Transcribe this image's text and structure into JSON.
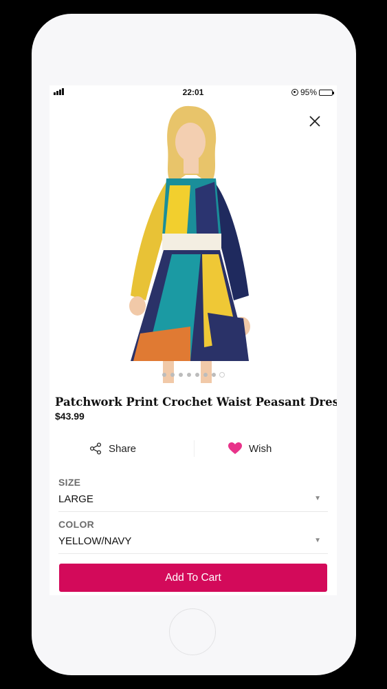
{
  "status_bar": {
    "time": "22:01",
    "battery_percent": "95%"
  },
  "product": {
    "title": "Patchwork Print Crochet Waist Peasant Dress",
    "price": "$43.99",
    "gallery": {
      "image_count": 8,
      "active_index": 7
    }
  },
  "actions": {
    "share_label": "Share",
    "wish_label": "Wish"
  },
  "options": {
    "size": {
      "label": "SIZE",
      "value": "LARGE"
    },
    "color": {
      "label": "COLOR",
      "value": "YELLOW/NAVY"
    }
  },
  "cart": {
    "button_label": "Add To Cart"
  },
  "colors": {
    "accent": "#d30a5a",
    "wish_heart": "#e8338a"
  }
}
